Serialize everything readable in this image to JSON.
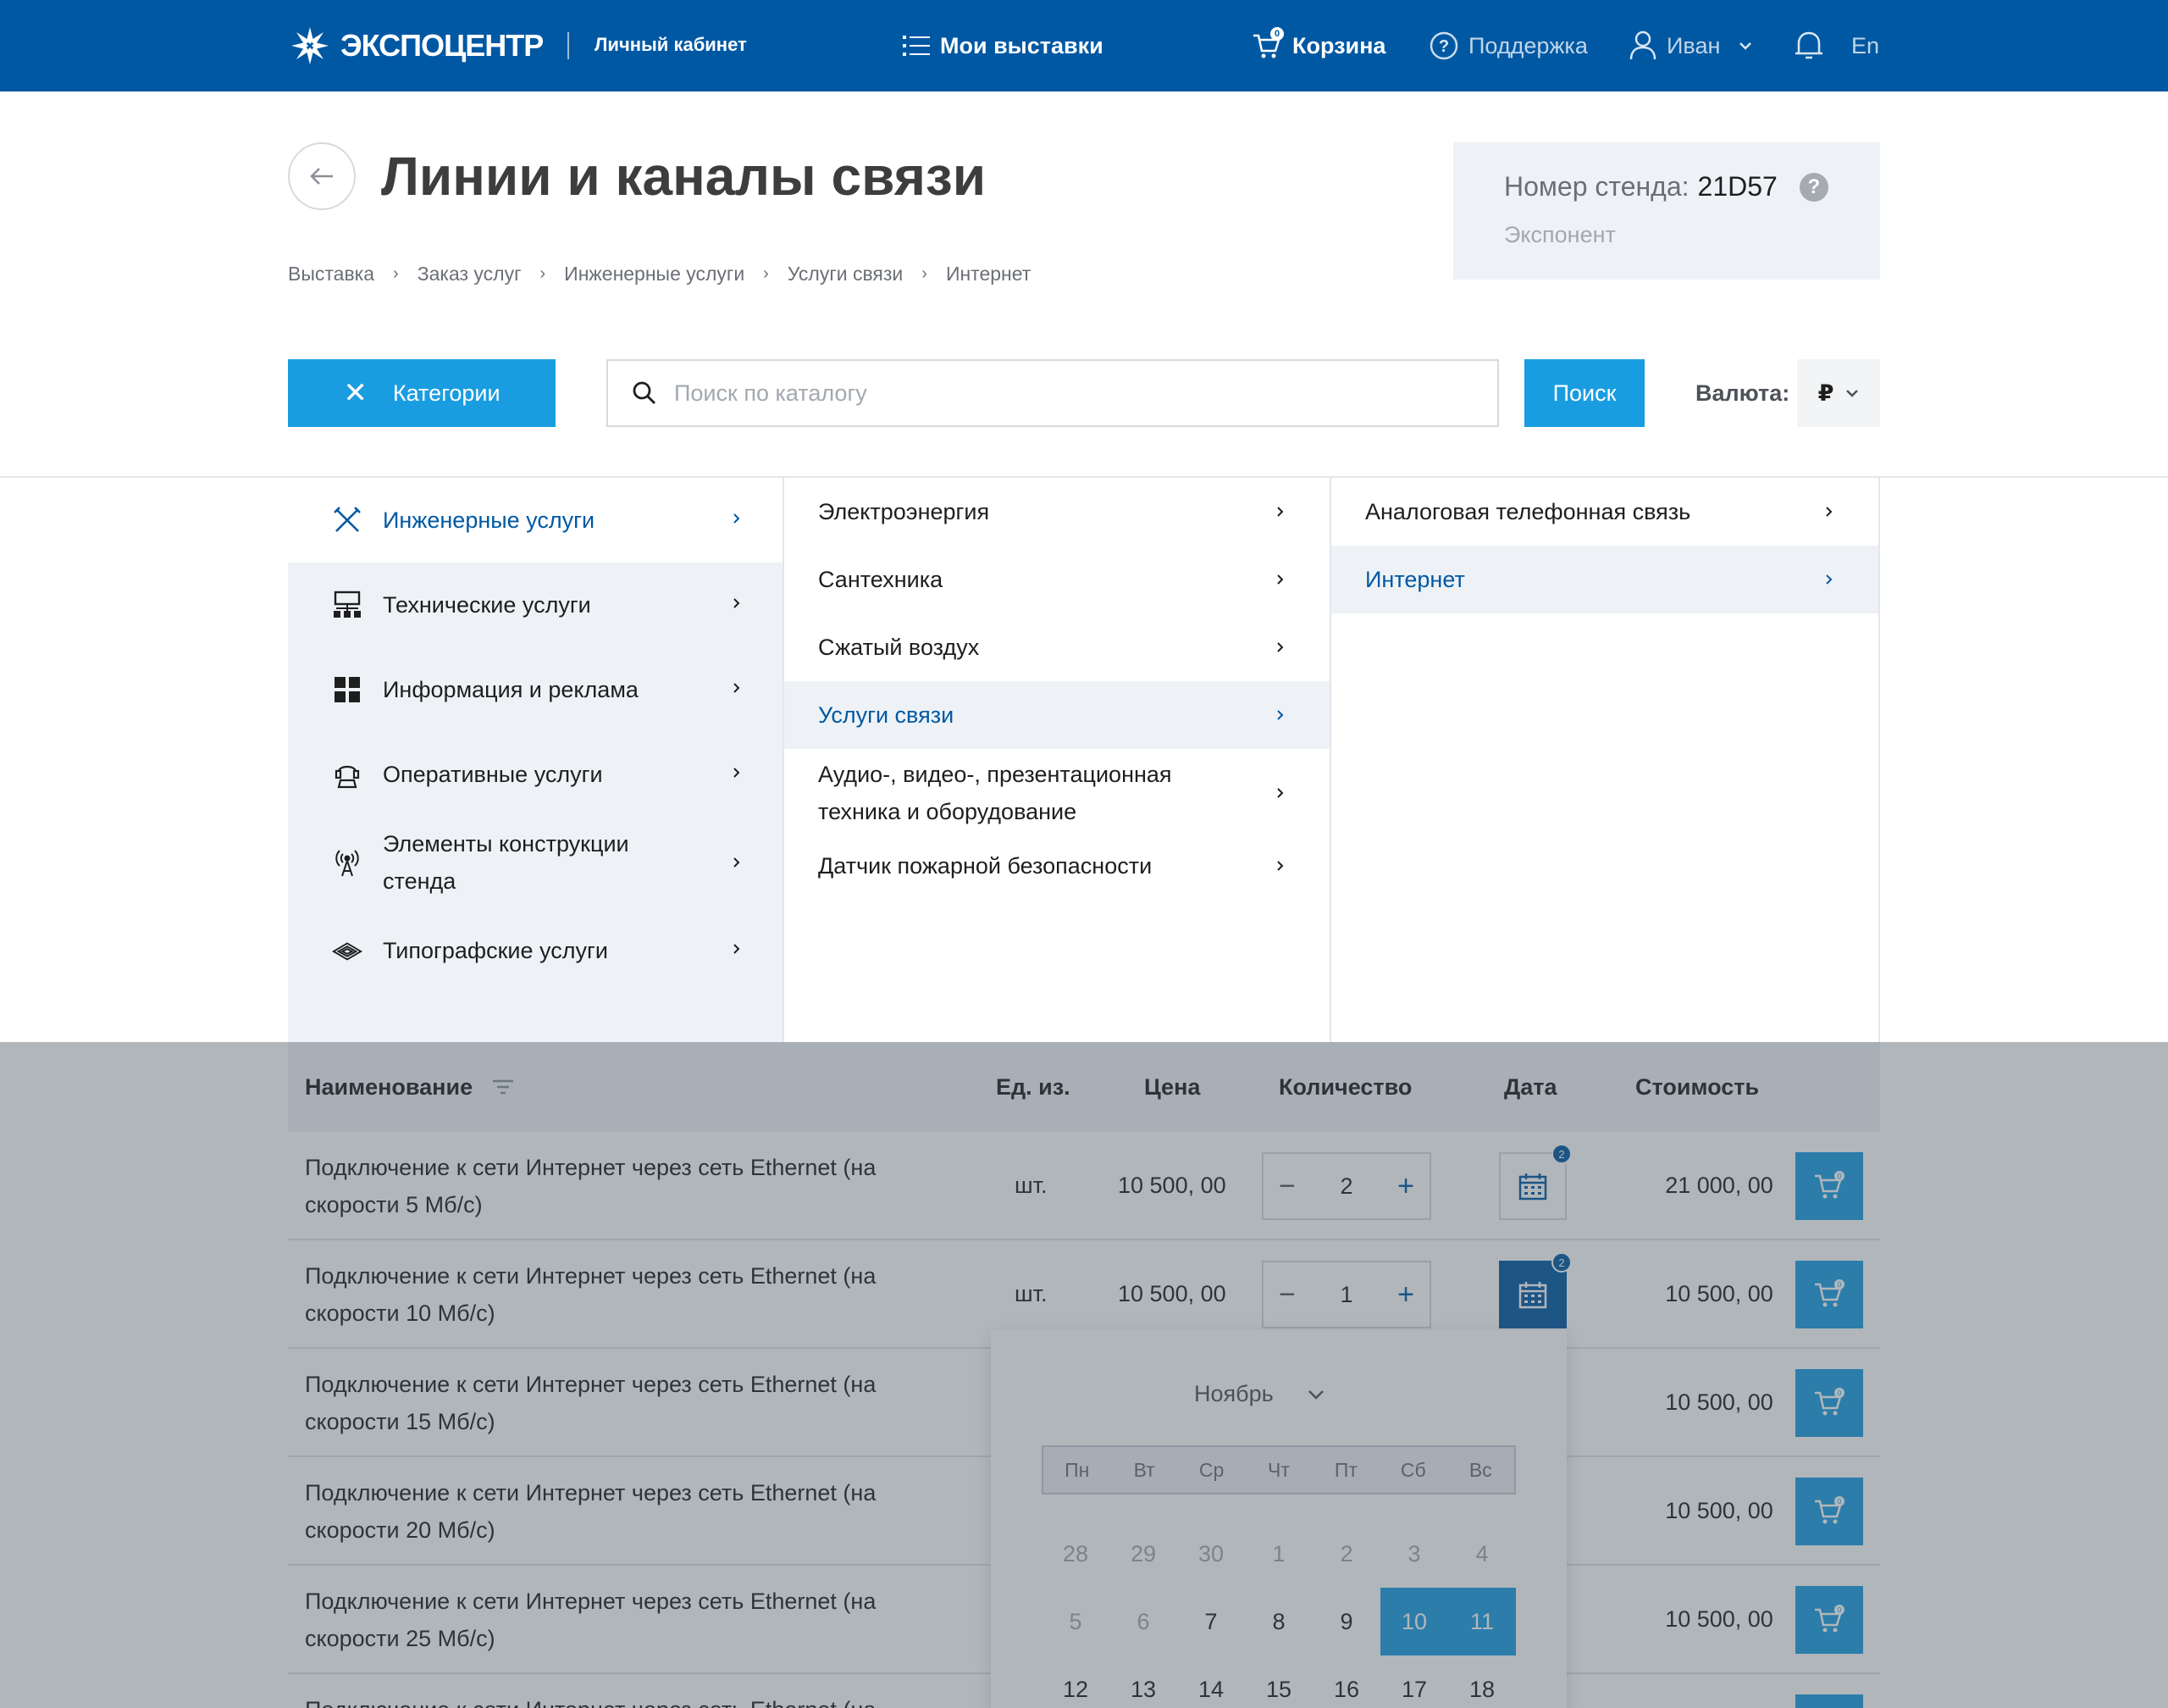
{
  "header": {
    "logo_text": "ЭКСПОЦЕНТР",
    "cabinet": "Личный кабинет",
    "my_exhibitions": "Мои выставки",
    "cart": "Корзина",
    "cart_badge": "0",
    "support": "Поддержка",
    "user": "Иван",
    "lang": "En"
  },
  "page": {
    "title": "Линии и каналы связи",
    "breadcrumb": [
      "Выставка",
      "Заказ услуг",
      "Инженерные услуги",
      "Услуги связи",
      "Интернет"
    ],
    "stand_label": "Номер стенда:",
    "stand_number": "21D57",
    "stand_help": "?",
    "role": "Экспонент"
  },
  "toolbar": {
    "categories_label": "Категории",
    "categories_close": "✕",
    "search_placeholder": "Поиск по каталогу",
    "search_button": "Поиск",
    "currency_label": "Валюта:",
    "currency_value": "₽"
  },
  "menu": {
    "level1": [
      {
        "label": "Инженерные услуги",
        "icon": "tools-icon"
      },
      {
        "label": "Технические услуги",
        "icon": "network-icon"
      },
      {
        "label": "Информация и реклама",
        "icon": "grid-icon"
      },
      {
        "label": "Оперативные услуги",
        "icon": "operator-icon"
      },
      {
        "label": "Элементы конструкции стенда",
        "icon": "antenna-icon"
      },
      {
        "label": "Типографские услуги",
        "icon": "print-icon"
      }
    ],
    "level2": [
      {
        "label": "Электроэнергия"
      },
      {
        "label": "Сантехника"
      },
      {
        "label": "Сжатый воздух"
      },
      {
        "label": "Услуги связи"
      },
      {
        "label": "Аудио-, видео-, презентационная техника и оборудование"
      },
      {
        "label": "Датчик пожарной безопасности"
      }
    ],
    "level3": [
      {
        "label": "Аналоговая телефонная связь"
      },
      {
        "label": "Интернет"
      }
    ]
  },
  "table": {
    "headers": {
      "name": "Наименование",
      "unit": "Ед. из.",
      "price": "Цена",
      "qty": "Количество",
      "date": "Дата",
      "cost": "Стоимость"
    },
    "rows": [
      {
        "name": "Подключение к сети Интернет через сеть Ethernet (на скорости 5 Мб/с)",
        "unit": "шт.",
        "price": "10 500, 00",
        "qty": "2",
        "date_badge": "2",
        "cost": "21 000, 00"
      },
      {
        "name": "Подключение к сети Интернет через сеть Ethernet (на скорости 10 Мб/с)",
        "unit": "шт.",
        "price": "10 500, 00",
        "qty": "1",
        "date_badge": "2",
        "cost": "10 500, 00"
      },
      {
        "name": "Подключение к сети Интернет через сеть Ethernet (на скорости 15 Мб/с)",
        "cost": "10 500, 00",
        "cart_badge": "0"
      },
      {
        "name": "Подключение к сети Интернет через сеть Ethernet (на скорости 20 Мб/с)",
        "cost": "10 500, 00",
        "cart_badge": "0"
      },
      {
        "name": "Подключение к сети Интернет через сеть Ethernet (на скорости 25 Мб/с)",
        "cost": "10 500, 00",
        "cart_badge": "0"
      },
      {
        "name": "Подключение к сети Интернет через сеть Ethernet (на"
      }
    ],
    "qty_minus": "−",
    "qty_plus": "+",
    "cart_badge": "0"
  },
  "calendar": {
    "month": "Ноябрь",
    "weekdays": [
      "Пн",
      "Вт",
      "Ср",
      "Чт",
      "Пт",
      "Сб",
      "Вс"
    ],
    "weeks": [
      [
        "28",
        "29",
        "30",
        "1",
        "2",
        "3",
        "4"
      ],
      [
        "5",
        "6",
        "7",
        "8",
        "9",
        "10",
        "11"
      ],
      [
        "12",
        "13",
        "14",
        "15",
        "16",
        "17",
        "18"
      ]
    ],
    "muted": [
      [
        0,
        1,
        2,
        3,
        4,
        5,
        6
      ],
      [
        0,
        1
      ]
    ],
    "selected": [
      "10",
      "11"
    ]
  },
  "colors": {
    "brand": "#0058a3",
    "accent": "#1a9de0",
    "menu_bg": "#eef2f6"
  }
}
